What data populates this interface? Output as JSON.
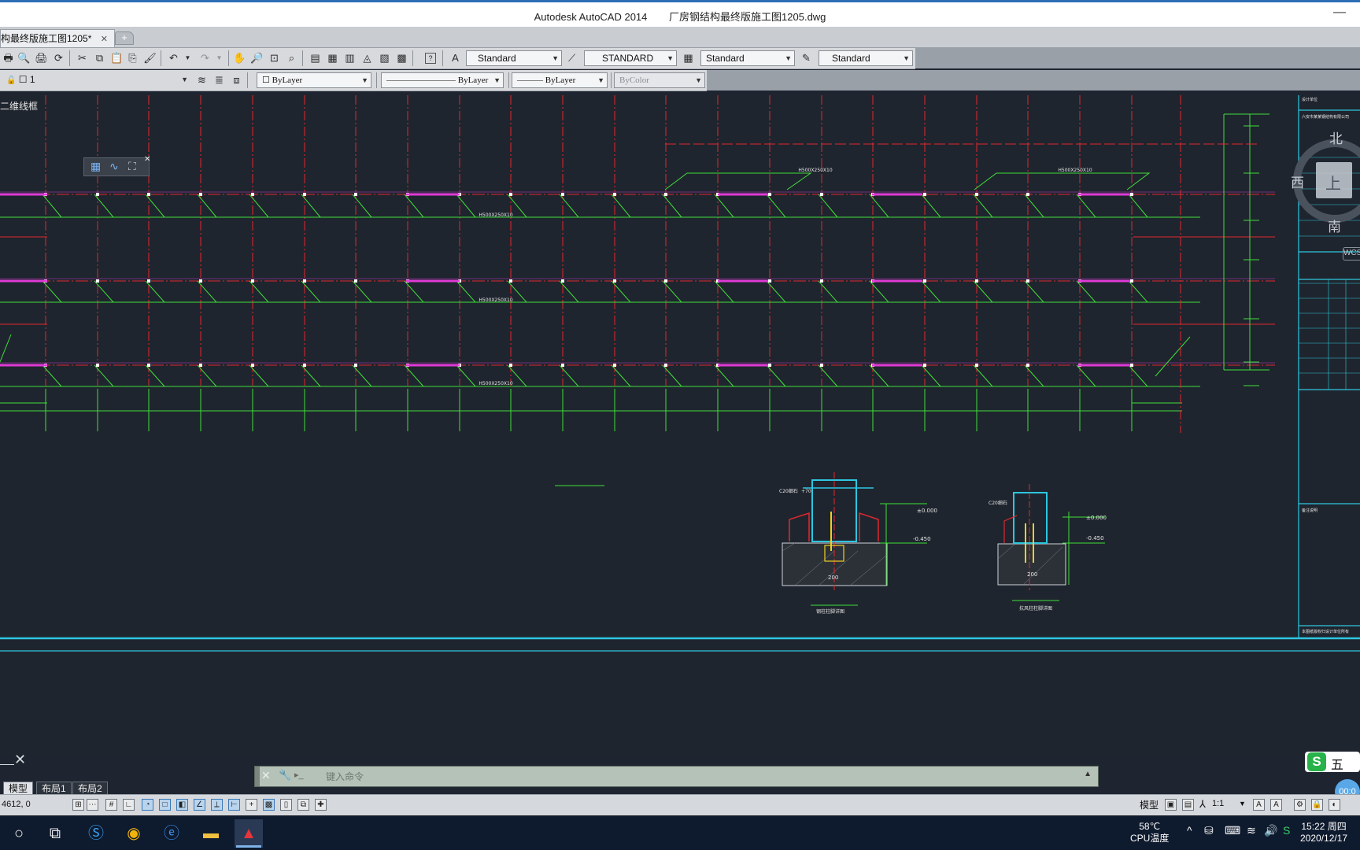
{
  "window": {
    "app_title": "Autodesk AutoCAD 2014",
    "file_title": "厂房钢结构最终版施工图1205.dwg",
    "minimize": "—"
  },
  "tabs": {
    "doc_tab": "构最终版施工图1205*",
    "close": "✕",
    "new": "+"
  },
  "toolbar1": {
    "text_style": "Standard",
    "dim_style": "STANDARD",
    "table_style": "Standard",
    "mleader_style": "Standard",
    "help": "?"
  },
  "toolbar2": {
    "layer": "1",
    "color": "ByLayer",
    "linetype": "ByLayer",
    "lineweight": "ByLayer",
    "plotstyle": "ByColor"
  },
  "canvas": {
    "view_label": "二维线框",
    "beam_label": "H500X250X10",
    "beam_label_top": "H500X250X10",
    "detail1_caption": "钢柱柱脚详图",
    "detail2_caption": "抗风柱柱脚详图",
    "dim_texts": [
      "±0.000",
      "-0.450",
      "200",
      "C20细石",
      "+70"
    ]
  },
  "compass": {
    "north": "北",
    "west": "西",
    "south": "南",
    "top": "上",
    "wcs": "WCS"
  },
  "commandline": {
    "prompt": "键入命令",
    "close": "✕",
    "settings": "🔧",
    "expand": "▲"
  },
  "layout_tabs": [
    "模型",
    "布局1",
    "布局2"
  ],
  "statusbar": {
    "coords": "4612,  0",
    "model": "模型",
    "scale": "1:1"
  },
  "taskbar": {
    "temperature": "58℃",
    "temp_label": "CPU温度",
    "time": "15:22 周四",
    "date": "2020/12/17"
  },
  "ime": {
    "logo": "S",
    "label": "五"
  },
  "timer": "00:0"
}
